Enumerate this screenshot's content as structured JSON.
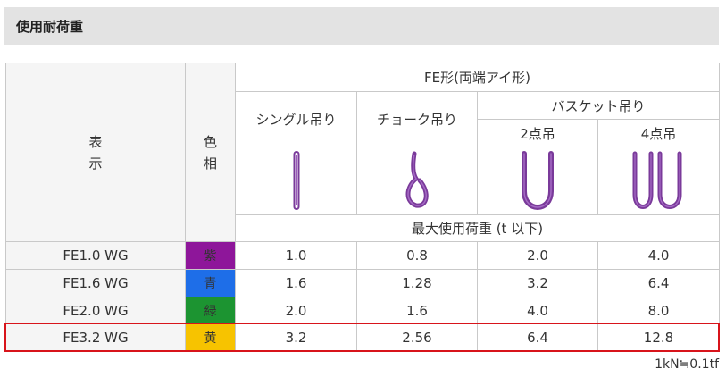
{
  "title": "使用耐荷重",
  "header": {
    "group": "FE形(両端アイ形)",
    "col_hyoji": [
      "表",
      "示"
    ],
    "col_iro": [
      "色",
      "相"
    ],
    "single": "シングル吊り",
    "choke": "チョーク吊り",
    "basket": "バスケット吊り",
    "basket_2": "2点吊",
    "basket_4": "4点吊",
    "max_load": "最大使用荷重 (t 以下)"
  },
  "icons": [
    "single-sling-icon",
    "choke-sling-icon",
    "basket-2point-sling-icon",
    "basket-4point-sling-icon"
  ],
  "sling_color": "#7a3a9a",
  "rows": [
    {
      "name": "FE1.0 WG",
      "color_label": "紫",
      "color": "#8e169a",
      "single": "1.0",
      "choke": "0.8",
      "basket2": "2.0",
      "basket4": "4.0"
    },
    {
      "name": "FE1.6 WG",
      "color_label": "青",
      "color": "#1e6ee8",
      "single": "1.6",
      "choke": "1.28",
      "basket2": "3.2",
      "basket4": "6.4"
    },
    {
      "name": "FE2.0 WG",
      "color_label": "緑",
      "color": "#1c9431",
      "single": "2.0",
      "choke": "1.6",
      "basket2": "4.0",
      "basket4": "8.0"
    },
    {
      "name": "FE3.2 WG",
      "color_label": "黄",
      "color": "#f7c300",
      "single": "3.2",
      "choke": "2.56",
      "basket2": "6.4",
      "basket4": "12.8",
      "highlighted": true
    }
  ],
  "highlight_color": "#d8141b",
  "footnote": "1kN≒0.1tf"
}
